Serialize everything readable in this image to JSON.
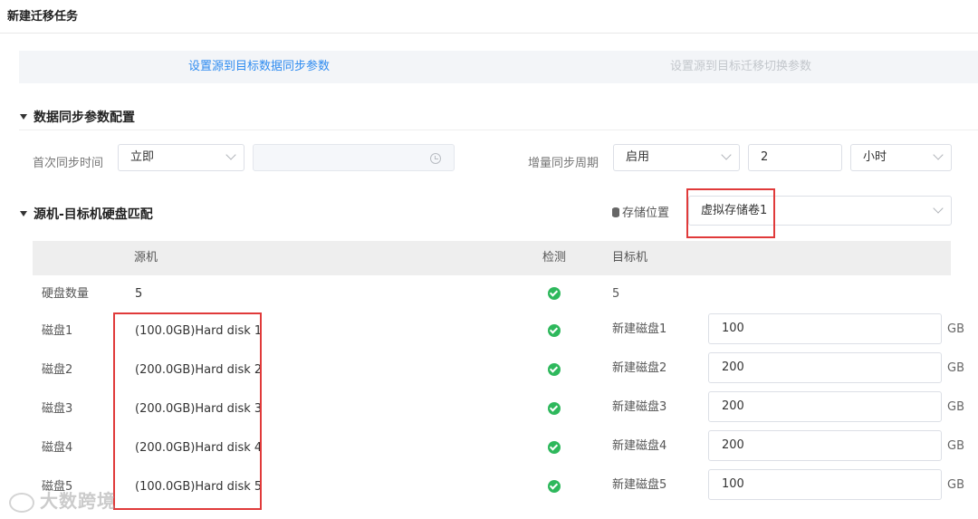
{
  "header": {
    "title": "新建迁移任务"
  },
  "steps": [
    {
      "label": "设置源到目标数据同步参数",
      "active": true
    },
    {
      "label": "设置源到目标迁移切换参数",
      "active": false
    }
  ],
  "sync_section": {
    "title": "数据同步参数配置",
    "first_sync": {
      "label": "首次同步时间",
      "value": "立即",
      "time_value": ""
    },
    "incremental": {
      "label": "增量同步周期",
      "mode": "启用",
      "interval": "2",
      "unit": "小时"
    }
  },
  "disk_section": {
    "title": "源机-目标机硬盘匹配",
    "storage_label": "存储位置",
    "storage_value": "虚拟存储卷1"
  },
  "table": {
    "headers": {
      "source": "源机",
      "check": "检测",
      "target": "目标机"
    },
    "count_row": {
      "label": "硬盘数量",
      "source": "5",
      "target": "5"
    },
    "rows": [
      {
        "label": "磁盘1",
        "source": "(100.0GB)Hard disk 1",
        "target": "新建磁盘1",
        "size": "100",
        "unit": "GB"
      },
      {
        "label": "磁盘2",
        "source": "(200.0GB)Hard disk 2",
        "target": "新建磁盘2",
        "size": "200",
        "unit": "GB"
      },
      {
        "label": "磁盘3",
        "source": "(200.0GB)Hard disk 3",
        "target": "新建磁盘3",
        "size": "200",
        "unit": "GB"
      },
      {
        "label": "磁盘4",
        "source": "(200.0GB)Hard disk 4",
        "target": "新建磁盘4",
        "size": "200",
        "unit": "GB"
      },
      {
        "label": "磁盘5",
        "source": "(100.0GB)Hard disk 5",
        "target": "新建磁盘5",
        "size": "100",
        "unit": "GB"
      }
    ]
  },
  "watermark": "大数跨境",
  "colors": {
    "accent": "#2f8cf0",
    "success": "#2eb85c",
    "highlight": "#e03a3a"
  }
}
